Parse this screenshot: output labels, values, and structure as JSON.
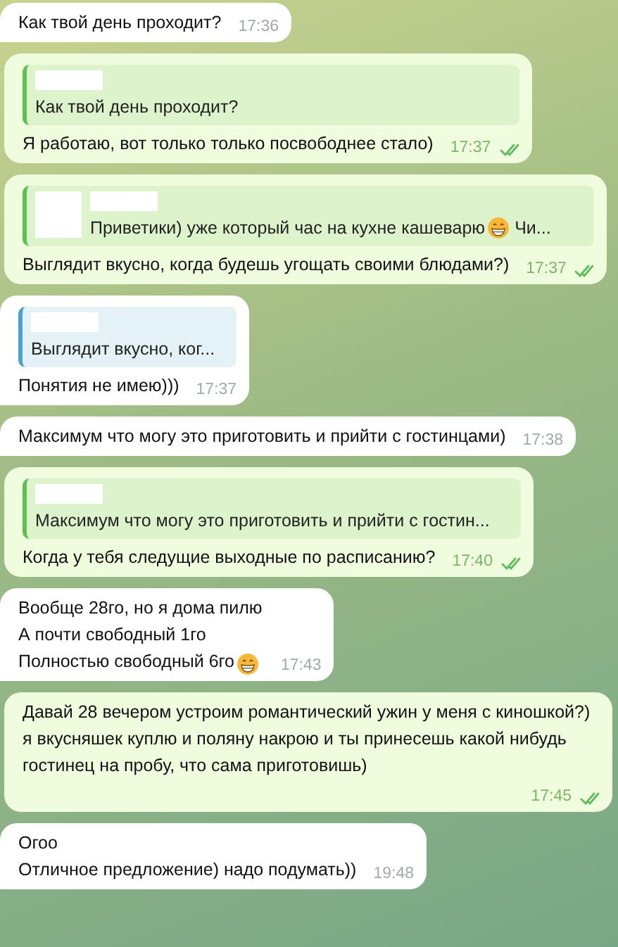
{
  "messages": [
    {
      "kind": "in",
      "lines": [
        [
          {
            "kind": "text",
            "text": "Как твой день проходит?"
          }
        ]
      ],
      "time": "17:36"
    },
    {
      "kind": "out",
      "reply": {
        "name_redacted": true,
        "thumbnail": false,
        "parts": [
          {
            "kind": "text",
            "text": "Как твой день проходит?"
          }
        ]
      },
      "lines": [
        [
          {
            "kind": "text",
            "text": "Я работаю, вот только только посвободнее стало)"
          }
        ]
      ],
      "time": "17:37",
      "read": true
    },
    {
      "kind": "out",
      "reply": {
        "name_redacted": true,
        "thumbnail": true,
        "parts": [
          {
            "kind": "text",
            "text": "Приветики) уже который час на кухне кашеварю"
          },
          {
            "kind": "emoji"
          },
          {
            "kind": "text",
            "text": "Чи..."
          }
        ]
      },
      "lines": [
        [
          {
            "kind": "text",
            "text": "Выглядит вкусно, когда будешь угощать своими блюдами?)"
          }
        ]
      ],
      "time": "17:37",
      "read": true
    },
    {
      "kind": "in",
      "reply": {
        "name_redacted": true,
        "thumbnail": false,
        "parts": [
          {
            "kind": "text",
            "text": "Выглядит вкусно, ког..."
          }
        ]
      },
      "lines": [
        [
          {
            "kind": "text",
            "text": "Понятия не имею)))"
          }
        ]
      ],
      "time": "17:37"
    },
    {
      "kind": "in",
      "lines": [
        [
          {
            "kind": "text",
            "text": "Максимум что могу это приготовить и прийти с гостинцами)"
          }
        ]
      ],
      "time": "17:38"
    },
    {
      "kind": "out",
      "reply": {
        "name_redacted": true,
        "thumbnail": false,
        "parts": [
          {
            "kind": "text",
            "text": "Максимум что могу это приготовить и прийти с гостин..."
          }
        ]
      },
      "lines": [
        [
          {
            "kind": "text",
            "text": "Когда у тебя следущие выходные по расписанию?"
          }
        ]
      ],
      "time": "17:40",
      "read": true
    },
    {
      "kind": "in",
      "lines": [
        [
          {
            "kind": "text",
            "text": "Вообще 28го, но я дома пилю"
          }
        ],
        [
          {
            "kind": "text",
            "text": "А почти свободный 1го"
          }
        ],
        [
          {
            "kind": "text",
            "text": "Полностью свободный 6го"
          },
          {
            "kind": "emoji"
          }
        ]
      ],
      "time": "17:43"
    },
    {
      "kind": "out",
      "lines": [
        [
          {
            "kind": "text",
            "text": "Давай 28 вечером устроим романтический ужин у меня с киношкой?) я вкусняшек куплю и поляну накрою и ты принесешь какой нибудь гостинец на пробу, что сама приготовишь)"
          }
        ]
      ],
      "time": "17:45",
      "read": true
    },
    {
      "kind": "in",
      "lines": [
        [
          {
            "kind": "text",
            "text": "Огоо"
          }
        ],
        [
          {
            "kind": "text",
            "text": "Отличное предложение) надо подумать))"
          }
        ]
      ],
      "time": "19:48"
    }
  ]
}
